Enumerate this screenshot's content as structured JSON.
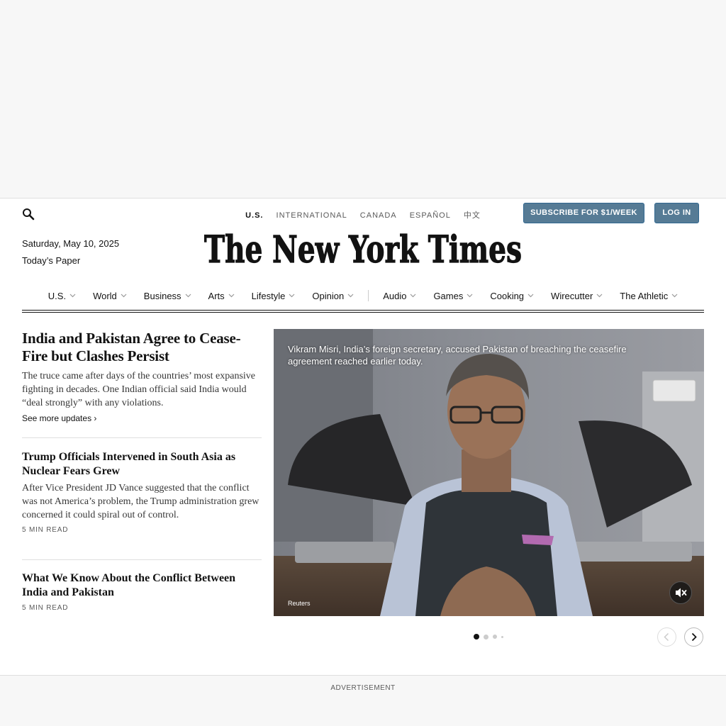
{
  "header": {
    "editions": [
      "U.S.",
      "INTERNATIONAL",
      "CANADA",
      "ESPAÑOL",
      "中文"
    ],
    "active_edition": "U.S.",
    "subscribe_label": "SUBSCRIBE FOR $1/WEEK",
    "login_label": "LOG IN",
    "date": "Saturday, May 10, 2025",
    "todays_paper": "Today’s Paper",
    "masthead": "The New York Times"
  },
  "nav": {
    "items": [
      "U.S.",
      "World",
      "Business",
      "Arts",
      "Lifestyle",
      "Opinion",
      "Audio",
      "Games",
      "Cooking",
      "Wirecutter",
      "The Athletic"
    ]
  },
  "stories": [
    {
      "headline": "India and Pakistan Agree to Cease-Fire but Clashes Persist",
      "summary": "The truce came after days of the countries’ most expansive fighting in decades. One Indian official said India would “deal strongly” with any violations.",
      "link": "See more updates ›"
    },
    {
      "headline": "Trump Officials Intervened in South Asia as Nuclear Fears Grew",
      "summary": "After Vice President JD Vance suggested that the conflict was not America’s problem, the Trump administration grew concerned it could spiral out of control.",
      "readtime": "5 MIN READ"
    },
    {
      "headline": "What We Know About the Conflict Between India and Pakistan",
      "readtime": "5 MIN READ"
    }
  ],
  "media": {
    "caption": "Vikram Misri, India’s foreign secretary, accused Pakistan of breaching the ceasefire agreement reached earlier today.",
    "credit": "Reuters"
  },
  "carousel": {
    "count": 4,
    "active": 1
  },
  "ad": {
    "label": "ADVERTISEMENT"
  },
  "icons": {
    "search": "search-icon",
    "mute": "mute-icon",
    "prev": "chevron-left-icon",
    "next": "chevron-right-icon",
    "nav_dropdown": "chevron-down-icon"
  },
  "colors": {
    "button_blue": "#567b95",
    "text": "#121212",
    "muted": "#5a5a5a"
  }
}
